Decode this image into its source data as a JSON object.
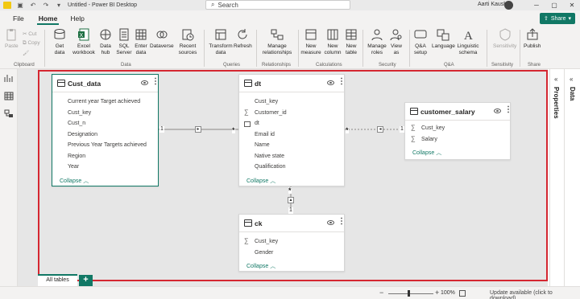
{
  "titlebar": {
    "title": "Untitled - Power BI Desktop",
    "search_placeholder": "Search",
    "user_name": "Aarti Kaushik"
  },
  "menu": {
    "file": "File",
    "home": "Home",
    "help": "Help",
    "share": "Share"
  },
  "ribbon": {
    "paste": "Paste",
    "cut": "Cut",
    "copy": "Copy",
    "clipboard_group": "Clipboard",
    "get_data": "Get data",
    "excel_workbook": "Excel workbook",
    "data_hub": "Data hub",
    "sql_server": "SQL Server",
    "enter_data": "Enter data",
    "dataverse": "Dataverse",
    "recent_sources": "Recent sources",
    "data_group": "Data",
    "transform_data": "Transform data",
    "refresh": "Refresh",
    "queries_group": "Queries",
    "manage_relationships": "Manage relationships",
    "relationships_group": "Relationships",
    "new_measure": "New measure",
    "new_column": "New column",
    "new_table": "New table",
    "calculations_group": "Calculations",
    "manage_roles": "Manage roles",
    "view_as": "View as",
    "security_group": "Security",
    "qa_setup": "Q&A setup",
    "language": "Language",
    "linguistic_schema": "Linguistic schema",
    "qa_group": "Q&A",
    "sensitivity": "Sensitivity",
    "sensitivity_group": "Sensitivity",
    "publish": "Publish",
    "share_group": "Share"
  },
  "tables": {
    "cust_data": {
      "name": "Cust_data",
      "fields": [
        "Current year Target achieved",
        "Cust_key",
        "Cust_n",
        "Designation",
        "Previous Year Targets achieved",
        "Region",
        "Year"
      ],
      "collapse": "Collapse"
    },
    "dt": {
      "name": "dt",
      "fields": [
        "Cust_key",
        "Customer_id",
        "dt",
        "Email id",
        "Name",
        "Native state",
        "Qualification"
      ],
      "collapse": "Collapse"
    },
    "customer_salary": {
      "name": "customer_salary",
      "fields": [
        "Cust_key",
        "Salary"
      ],
      "collapse": "Collapse"
    },
    "ck": {
      "name": "ck",
      "fields": [
        "Cust_key",
        "Gender"
      ],
      "collapse": "Collapse"
    }
  },
  "relationships": {
    "one": "1",
    "many": "*"
  },
  "panes": {
    "properties": "Properties",
    "data": "Data"
  },
  "bottom": {
    "page_tab": "All tables",
    "add_page": "+",
    "zoom": "100%",
    "update": "Update available (click to download)"
  },
  "colors": {
    "accent": "#117865",
    "frame": "#d52731"
  }
}
